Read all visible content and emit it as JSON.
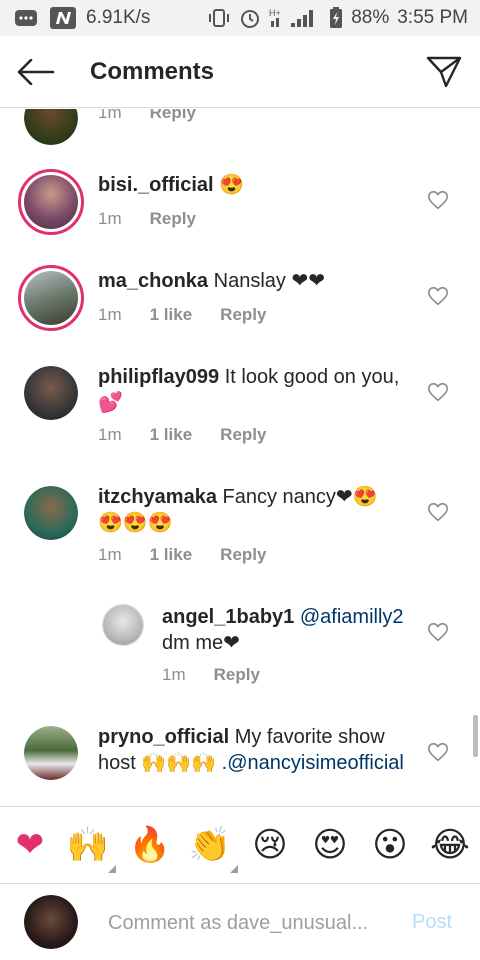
{
  "status_bar": {
    "speed": "6.91K/s",
    "network": "H+",
    "battery": "88%",
    "time": "3:55 PM",
    "icons": [
      "messages-icon",
      "n-app-icon",
      "vibrate-icon",
      "alarm-icon",
      "signal-icon",
      "battery-icon"
    ]
  },
  "header": {
    "title": "Comments",
    "back_icon": "back-arrow-icon",
    "send_icon": "direct-send-icon"
  },
  "comments": [
    {
      "username": "",
      "text": "",
      "time": "1m",
      "likes": "",
      "reply": "Reply",
      "avatar_color": "#3a2a1a",
      "story_ring": false
    },
    {
      "username": "bisi._official",
      "text": "😍",
      "time": "1m",
      "likes": "",
      "reply": "Reply",
      "avatar_color": "#8a5a7a",
      "story_ring": true
    },
    {
      "username": "ma_chonka",
      "text": "Nanslay ❤❤",
      "time": "1m",
      "likes": "1 like",
      "reply": "Reply",
      "avatar_color": "#6a7a6a",
      "story_ring": true
    },
    {
      "username": "philipflay099",
      "text": "It look good on you, 💕",
      "time": "1m",
      "likes": "1 like",
      "reply": "Reply",
      "avatar_color": "#3a3a3a",
      "story_ring": false
    },
    {
      "username": "itzchyamaka",
      "text": "Fancy nancy❤😍 😍😍😍",
      "time": "1m",
      "likes": "1 like",
      "reply": "Reply",
      "avatar_color": "#2a6a5a",
      "story_ring": false
    },
    {
      "username": "angel_1baby1",
      "mention": "@afiamilly2",
      "text": "dm me❤",
      "time": "1m",
      "likes": "",
      "reply": "Reply",
      "avatar_color": "#c8c8c8",
      "story_ring": false
    },
    {
      "username": "pryno_official",
      "text": "My favorite show host 🙌🙌🙌",
      "mention": ".@nancyisimeofficial",
      "time": "",
      "likes": "",
      "reply": "",
      "avatar_color": "#4a6a3a",
      "story_ring": false
    }
  ],
  "emoji_bar": [
    "❤",
    "🙌",
    "🔥",
    "👏",
    "😢",
    "😍",
    "😮",
    "😂"
  ],
  "composer": {
    "placeholder": "Comment as dave_unusual...",
    "post_label": "Post",
    "avatar_color": "#2a1a1a"
  },
  "colors": {
    "story_ring": "#e1306c",
    "mention": "#003569",
    "meta": "#8e8e8e",
    "post_disabled": "#b2dffc"
  }
}
